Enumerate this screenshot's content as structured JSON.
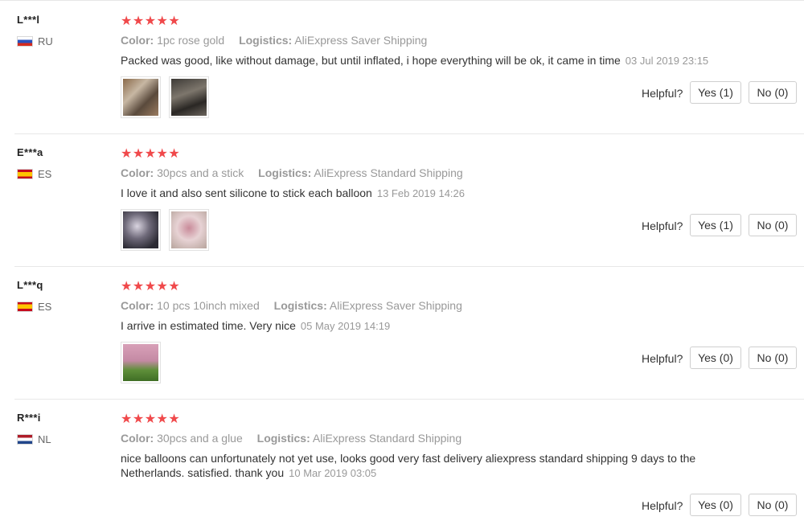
{
  "reviews": [
    {
      "user": "L***l",
      "country": "RU",
      "stars": "★★★★★",
      "color_label": "Color:",
      "color": "1pc rose gold",
      "logistics_label": "Logistics:",
      "logistics": "AliExpress Saver Shipping",
      "text": "Packed was good, like without damage, but until inflated, i hope everything will be ok, it came in time",
      "date": "03 Jul 2019 23:15",
      "helpful_label": "Helpful?",
      "yes": "Yes (1)",
      "no": "No (0)"
    },
    {
      "user": "E***a",
      "country": "ES",
      "stars": "★★★★★",
      "color_label": "Color:",
      "color": "30pcs and a stick",
      "logistics_label": "Logistics:",
      "logistics": "AliExpress Standard Shipping",
      "text": "I love it and also sent silicone to stick each balloon",
      "date": "13 Feb 2019 14:26",
      "helpful_label": "Helpful?",
      "yes": "Yes (1)",
      "no": "No (0)"
    },
    {
      "user": "L***q",
      "country": "ES",
      "stars": "★★★★★",
      "color_label": "Color:",
      "color": "10 pcs 10inch mixed",
      "logistics_label": "Logistics:",
      "logistics": "AliExpress Saver Shipping",
      "text": "I arrive in estimated time. Very nice",
      "date": "05 May 2019 14:19",
      "helpful_label": "Helpful?",
      "yes": "Yes (0)",
      "no": "No (0)"
    },
    {
      "user": "R***i",
      "country": "NL",
      "stars": "★★★★★",
      "color_label": "Color:",
      "color": "30pcs and a glue",
      "logistics_label": "Logistics:",
      "logistics": "AliExpress Standard Shipping",
      "text_line1": "nice balloons can unfortunately not yet use, looks good very fast delivery aliexpress standard shipping 9 days to the",
      "text_line2": "Netherlands.  satisfied.  thank you",
      "date": "10 Mar 2019 03:05",
      "helpful_label": "Helpful?",
      "yes": "Yes (0)",
      "no": "No (0)"
    }
  ]
}
